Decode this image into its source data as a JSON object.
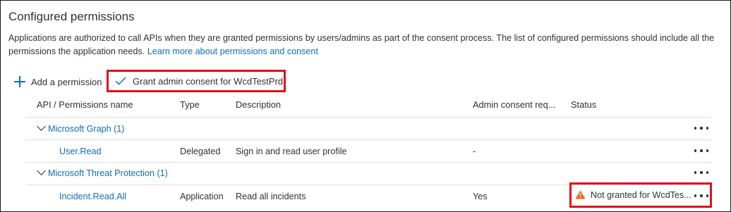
{
  "panel": {
    "title": "Configured permissions",
    "description": "Applications are authorized to call APIs when they are granted permissions by users/admins as part of the consent process. The list of configured permissions should include all the permissions the application needs.",
    "learn_more": "Learn more about permissions and consent"
  },
  "toolbar": {
    "add_label": "Add a permission",
    "grant_label": "Grant admin consent for WcdTestPrd"
  },
  "table": {
    "headers": {
      "name": "API / Permissions name",
      "type": "Type",
      "description": "Description",
      "admin": "Admin consent req...",
      "status": "Status"
    },
    "groups": [
      {
        "label": "Microsoft Graph (1)",
        "rows": [
          {
            "name": "User.Read",
            "type": "Delegated",
            "description": "Sign in and read user profile",
            "admin": "-",
            "status": ""
          }
        ]
      },
      {
        "label": "Microsoft Threat Protection (1)",
        "rows": [
          {
            "name": "Incident.Read.All",
            "type": "Application",
            "description": "Read all incidents",
            "admin": "Yes",
            "status": "Not granted for WcdTes..."
          }
        ]
      }
    ]
  },
  "icons": {
    "add": "plus-icon",
    "grant": "checkmark-icon",
    "expand": "chevron-down-icon",
    "more": "more-icon",
    "warning": "warning-icon"
  },
  "colors": {
    "link": "#0f6cbd",
    "highlight": "#e0101a",
    "warning": "#f7630c"
  }
}
